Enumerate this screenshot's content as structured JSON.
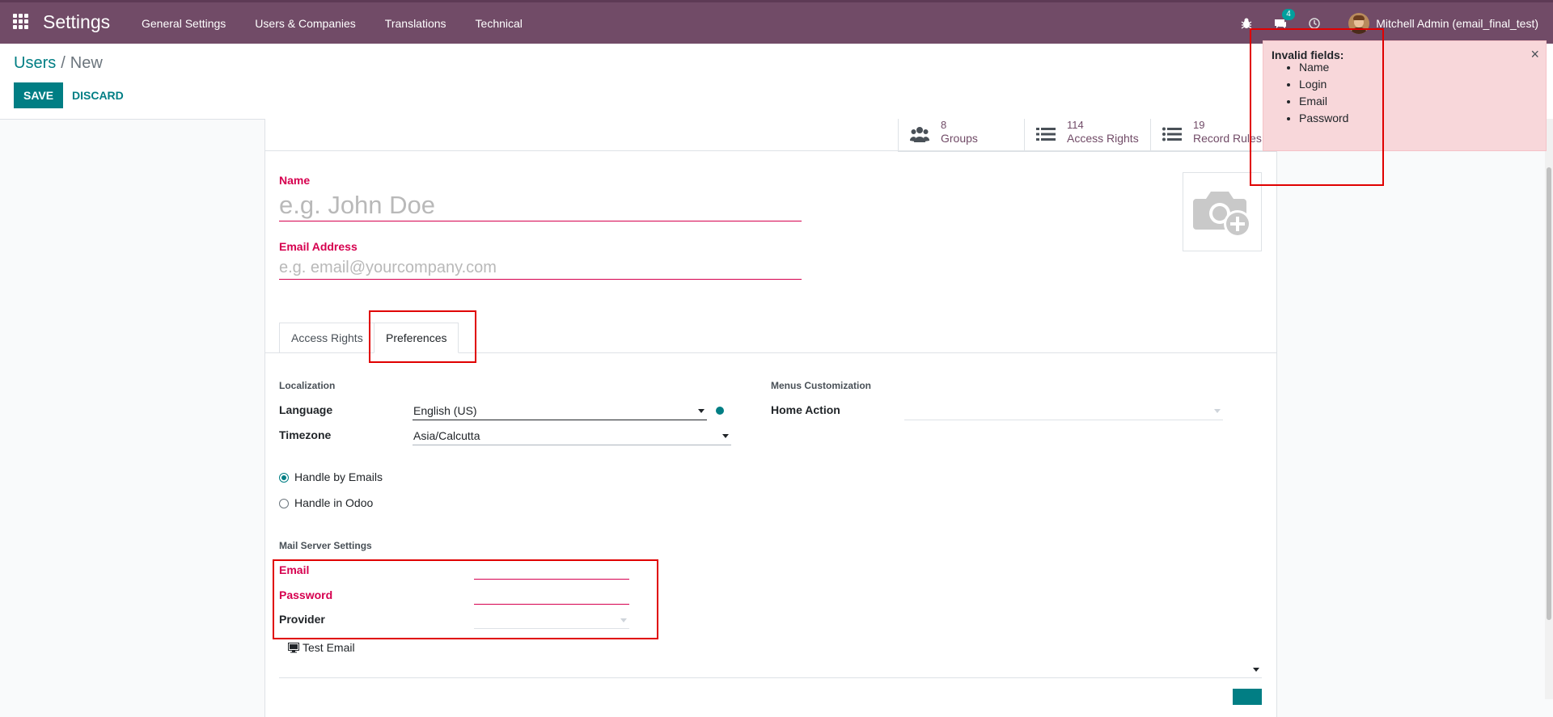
{
  "navbar": {
    "app_title": "Settings",
    "menu": [
      "General Settings",
      "Users & Companies",
      "Translations",
      "Technical"
    ],
    "chat_count": "4",
    "user_name": "Mitchell Admin (email_final_test)"
  },
  "breadcrumb": {
    "parent": "Users",
    "separator": "/",
    "current": "New"
  },
  "actions": {
    "save_label": "SAVE",
    "discard_label": "DISCARD"
  },
  "stat_buttons": [
    {
      "value": "8",
      "label": "Groups",
      "icon": "groups-icon"
    },
    {
      "value": "114",
      "label": "Access Rights",
      "icon": "list-icon"
    },
    {
      "value": "19",
      "label": "Record Rules",
      "icon": "list-icon"
    }
  ],
  "form": {
    "name_label": "Name",
    "name_placeholder": "e.g. John Doe",
    "email_label": "Email Address",
    "email_placeholder": "e.g. email@yourcompany.com",
    "avatar_icon": "camera-plus-icon"
  },
  "tabs": [
    "Access Rights",
    "Preferences"
  ],
  "preferences": {
    "localization_title": "Localization",
    "language_label": "Language",
    "language_value": "English (US)",
    "timezone_label": "Timezone",
    "timezone_value": "Asia/Calcutta",
    "menus_title": "Menus Customization",
    "home_action_label": "Home Action",
    "home_action_value": "",
    "notification_options": [
      "Handle by Emails",
      "Handle in Odoo"
    ],
    "notification_selected": "Handle by Emails",
    "mail_server_title": "Mail Server Settings",
    "mail_email_label": "Email",
    "mail_password_label": "Password",
    "mail_provider_label": "Provider",
    "test_email_label": "Test Email"
  },
  "notification": {
    "title": "Invalid fields:",
    "items": [
      "Name",
      "Login",
      "Email",
      "Password"
    ],
    "close": "×"
  },
  "colors": {
    "navbar": "#714b67",
    "accent": "#017e84",
    "invalid": "#d6004f",
    "notification_bg": "#f8d7da",
    "highlight": "#e00000"
  }
}
